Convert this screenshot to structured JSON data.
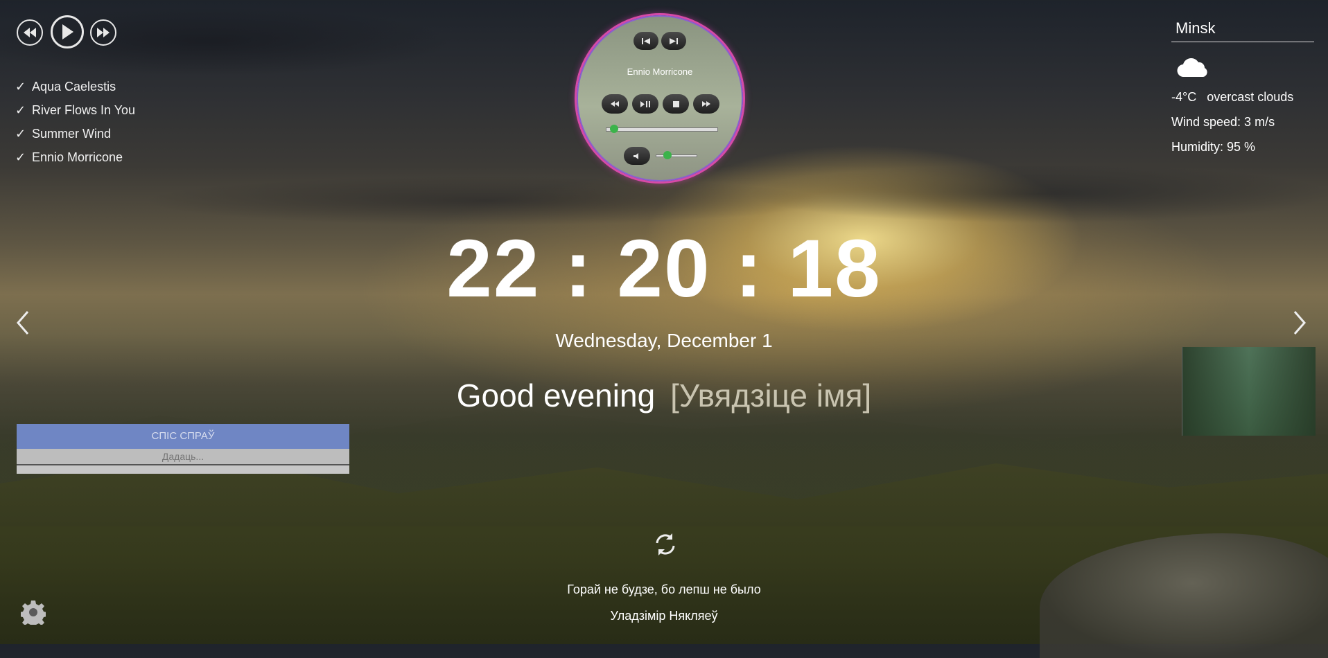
{
  "player": {
    "tracks": [
      "Aqua Caelestis",
      "River Flows In You",
      "Summer Wind",
      "Ennio Morricone"
    ],
    "check_glyph": "✓"
  },
  "round_player": {
    "title": "Ennio Morricone",
    "progress": 0.04,
    "volume": 0.3
  },
  "clock": {
    "time": "22 : 20 : 18",
    "date": "Wednesday, December 1",
    "greeting": "Good evening",
    "name_placeholder": "[Увядзіце імя]"
  },
  "weather": {
    "city": "Minsk",
    "icon": "cloud-icon",
    "temp_desc": "-4°C   overcast clouds",
    "wind": "Wind speed: 3 m/s",
    "humidity": "Humidity: 95 %"
  },
  "todo": {
    "title": "СПІС СПРАЎ",
    "input_placeholder": "Дадаць..."
  },
  "quote": {
    "text": "Горай не будзе, бо лепш не было",
    "author": "Уладзімір Някляеў"
  },
  "colors": {
    "todo_header": "#6f86c4",
    "accent_green": "#3bb34a",
    "ring_pink": "#d64aa8"
  }
}
